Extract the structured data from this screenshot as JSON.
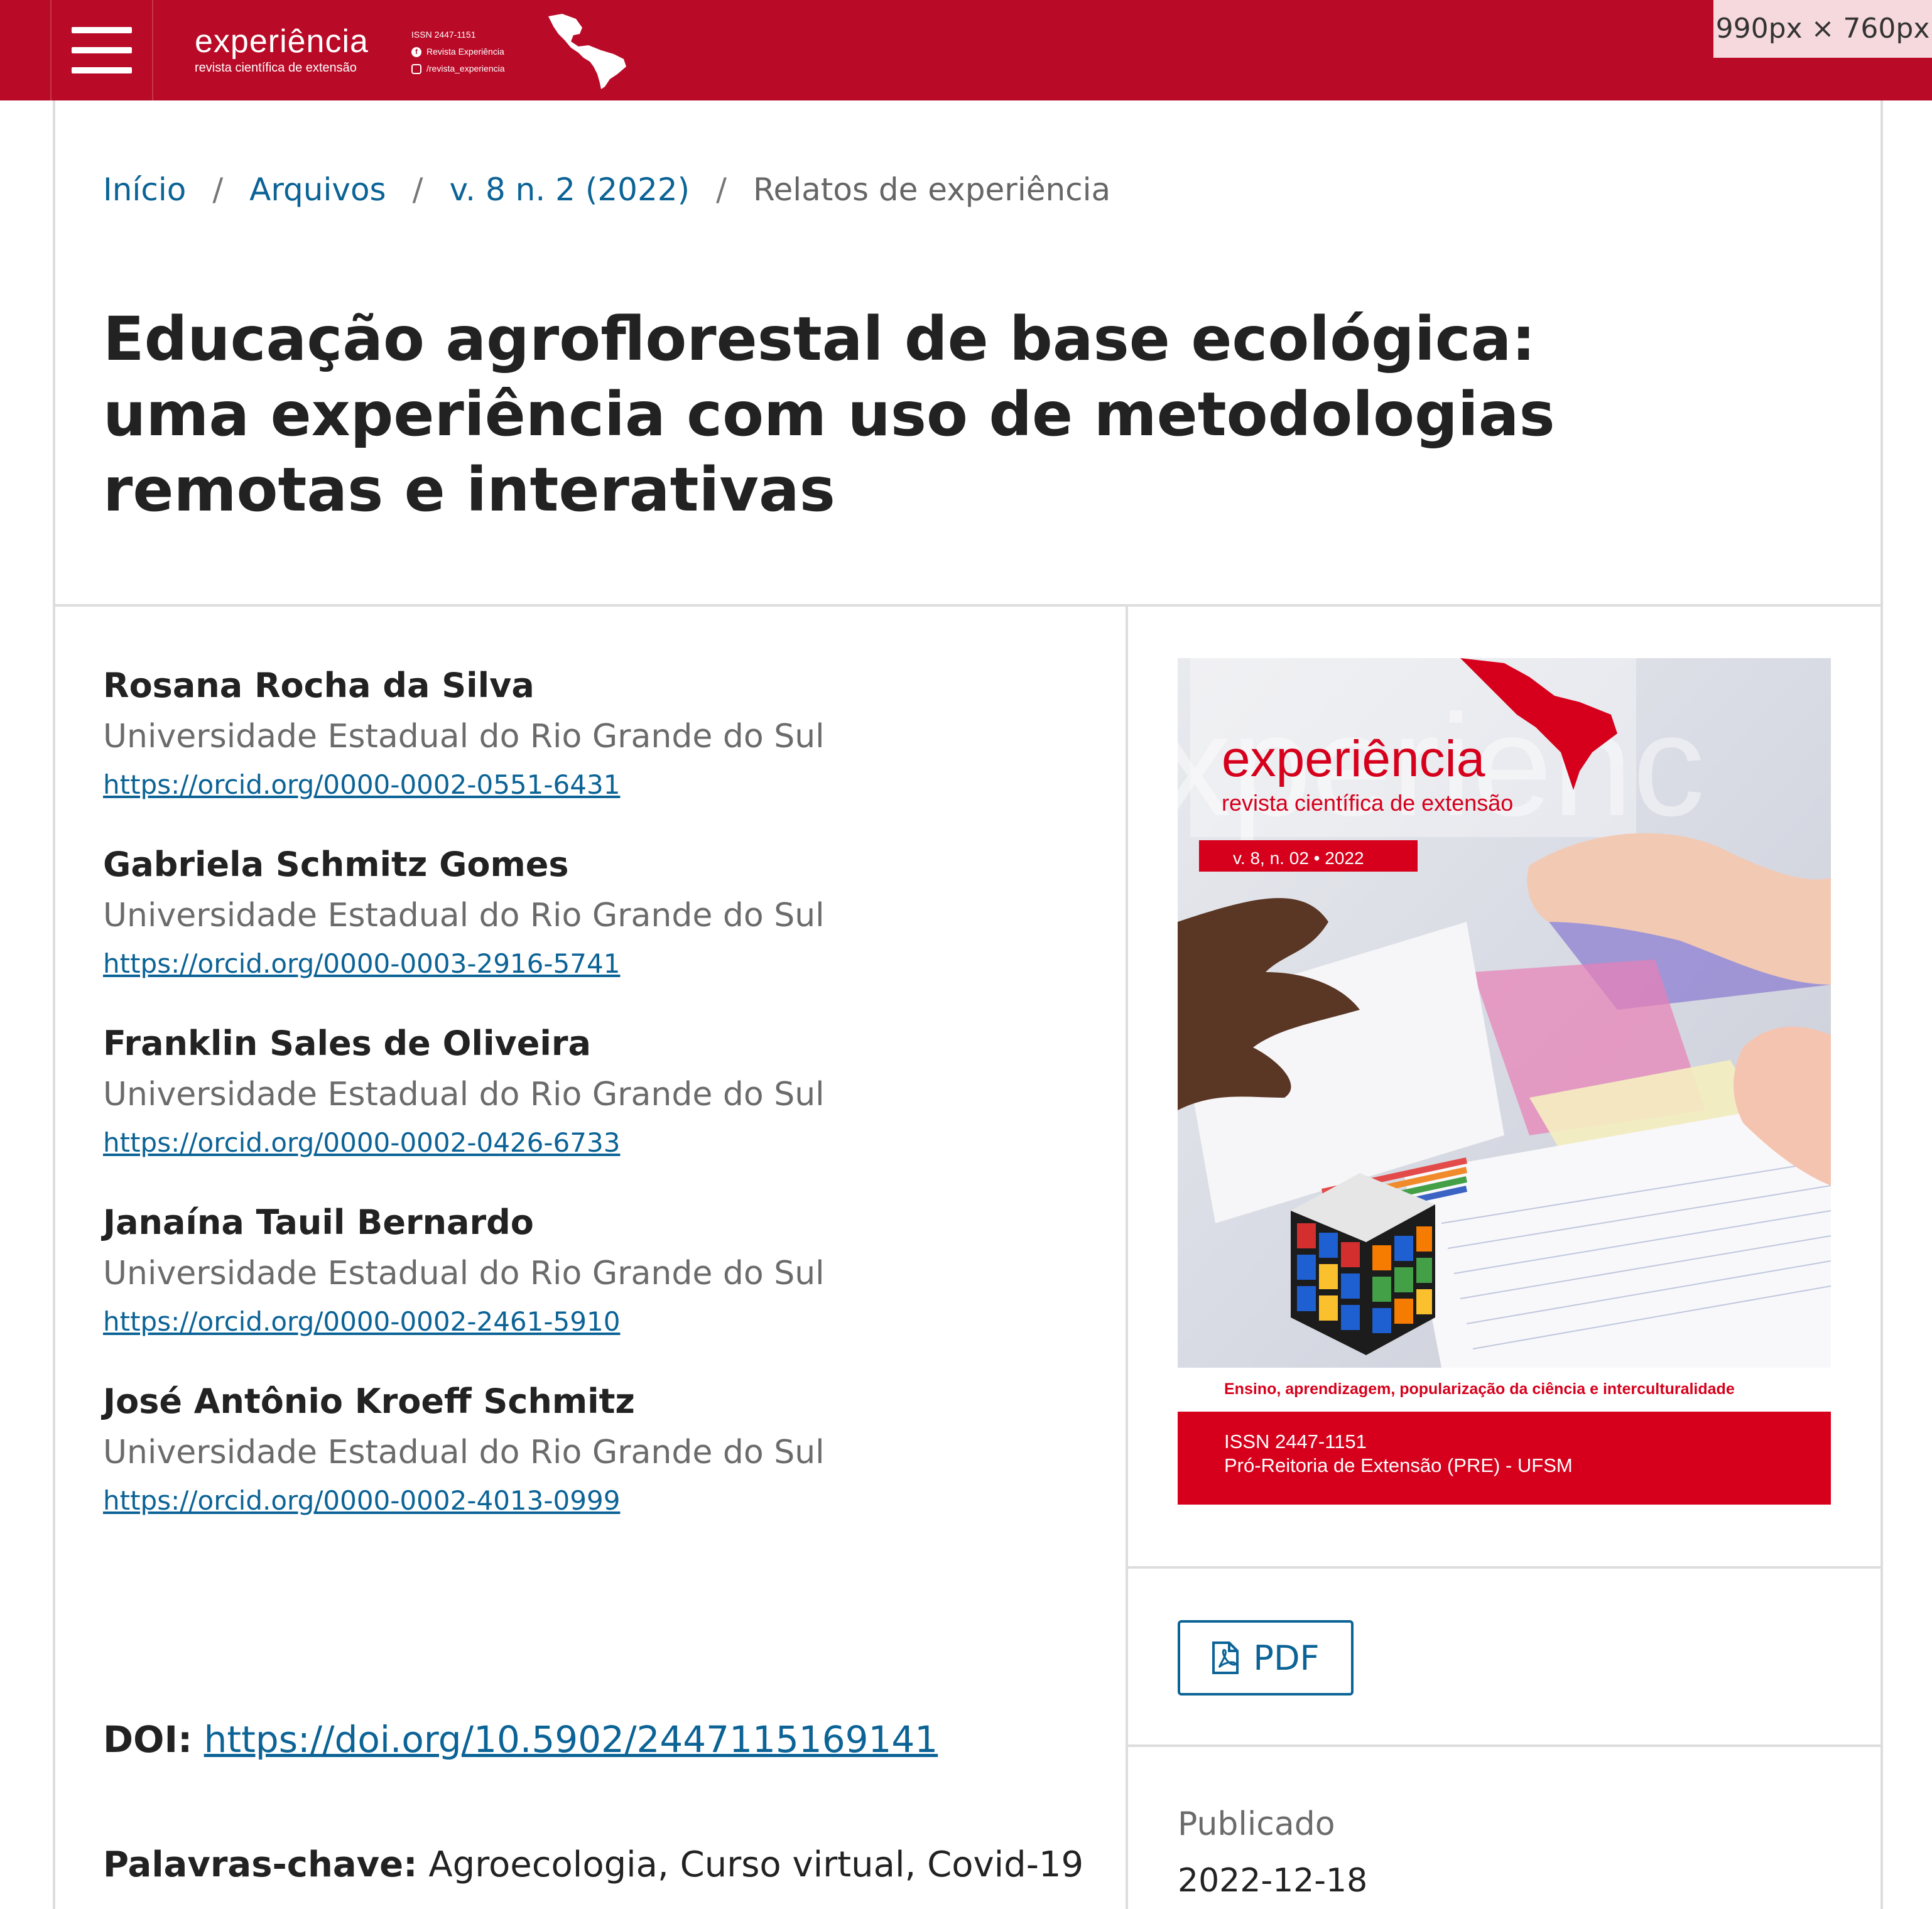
{
  "header": {
    "brand_name": "experiência",
    "brand_sub": "revista científica de extensão",
    "issn": "ISSN 2447-1151",
    "facebook": "Revista Experiência",
    "instagram": "/revista_experiencia",
    "menu_icon": "hamburger-menu-icon"
  },
  "viewport_badge": "990px × 760px",
  "breadcrumb": {
    "home": "Início",
    "archives": "Arquivos",
    "issue": "v. 8 n. 2 (2022)",
    "current": "Relatos de experiência",
    "separator": "/"
  },
  "article": {
    "title": "Educação agroflorestal de base ecológica: uma experiência com uso de metodologias remotas e interativas",
    "authors": [
      {
        "name": "Rosana Rocha da Silva",
        "affiliation": "Universidade Estadual do Rio Grande do Sul",
        "orcid": "https://orcid.org/0000-0002-0551-6431"
      },
      {
        "name": "Gabriela Schmitz Gomes",
        "affiliation": "Universidade Estadual do Rio Grande do Sul",
        "orcid": "https://orcid.org/0000-0003-2916-5741"
      },
      {
        "name": "Franklin Sales de Oliveira",
        "affiliation": "Universidade Estadual do Rio Grande do Sul",
        "orcid": "https://orcid.org/0000-0002-0426-6733"
      },
      {
        "name": "Janaína Tauil Bernardo",
        "affiliation": "Universidade Estadual do Rio Grande do Sul",
        "orcid": "https://orcid.org/0000-0002-2461-5910"
      },
      {
        "name": "José Antônio Kroeff Schmitz",
        "affiliation": "Universidade Estadual do Rio Grande do Sul",
        "orcid": "https://orcid.org/0000-0002-4013-0999"
      }
    ],
    "doi_label": "DOI:",
    "doi": "https://doi.org/10.5902/2447115169141",
    "keywords_label": "Palavras-chave:",
    "keywords": "Agroecologia, Curso virtual, Covid-19"
  },
  "cover": {
    "title": "experiência",
    "subtitle": "revista científica de extensão",
    "volume": "v. 8, n. 02 • 2022",
    "theme": "Ensino, aprendizagem, popularização da ciência e interculturalidade",
    "issn": "ISSN 2447-1151",
    "publisher": "Pró-Reitoria de Extensão (PRE) - UFSM"
  },
  "sidebar": {
    "pdf_label": "PDF",
    "pdf_icon": "pdf-file-icon",
    "published_label": "Publicado",
    "published_date": "2022-12-18"
  },
  "colors": {
    "header": "#b90a27",
    "link": "#0b6396",
    "cover_red": "#d6001c"
  }
}
